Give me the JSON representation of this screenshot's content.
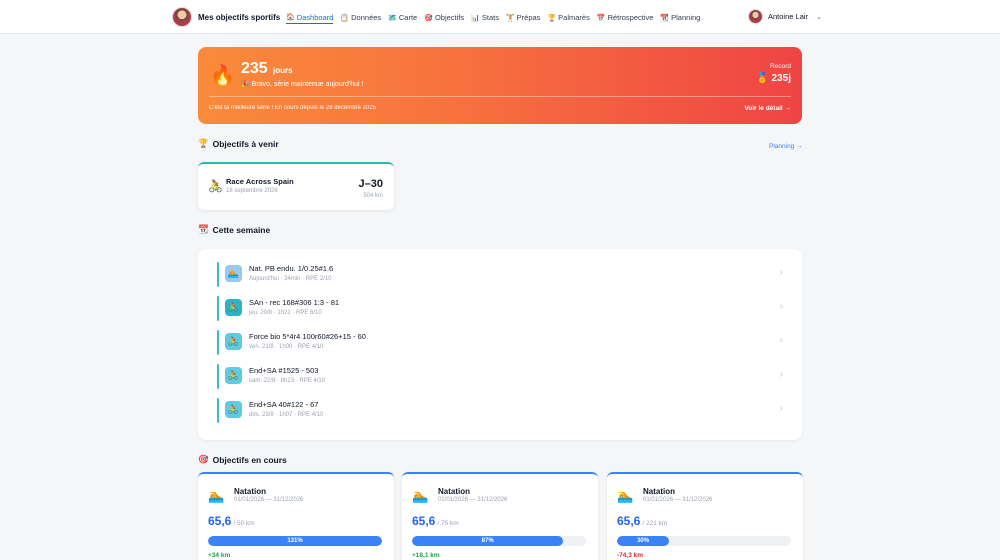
{
  "nav": {
    "brand": "Mes objectifs sportifs",
    "items": [
      {
        "icon": "🏠",
        "label": "Dashboard",
        "active": true
      },
      {
        "icon": "📋",
        "label": "Données"
      },
      {
        "icon": "🗺️",
        "label": "Carte"
      },
      {
        "icon": "🎯",
        "label": "Objectifs"
      },
      {
        "icon": "📊",
        "label": "Stats"
      },
      {
        "icon": "🏋️",
        "label": "Prépas"
      },
      {
        "icon": "🏆",
        "label": "Palmarès"
      },
      {
        "icon": "📅",
        "label": "Rétrospective"
      },
      {
        "icon": "📆",
        "label": "Planning"
      }
    ],
    "user": "Antoine Lair"
  },
  "streak": {
    "count": "235",
    "unit": "jours",
    "message": "🎉 Bravo, série maintenue aujourd'hui !",
    "record_label": "Record",
    "record_value": "235j",
    "footer": "C'est ta meilleure série ! En cours depuis le 28 décembre 2025",
    "link": "Voir le détail →"
  },
  "upcoming": {
    "title": "Objectifs à venir",
    "link": "Planning →",
    "goal": {
      "name": "Race Across Spain",
      "date": "18 septembre 2026",
      "countdown": "J–30",
      "distance": "504 km"
    }
  },
  "week": {
    "title": "Cette semaine",
    "sessions": [
      {
        "title": "Nat. PB endu. 1/0.25#1.6",
        "meta": "Aujourd'hui · 34min · RPE 2/10",
        "icon": "🏊",
        "bg": "#9ac8ee"
      },
      {
        "title": "SAn - rec 168#306 1:3 - 81",
        "meta": "jeu. 20/8 · 1h21 · RPE 6/10",
        "icon": "🚴",
        "bg": "#2bb3c9"
      },
      {
        "title": "Force bio 5*4r4 100r60#26+15 - 60",
        "meta": "ven. 21/8 · 1h00 · RPE 4/10",
        "icon": "🚴",
        "bg": "#5ecbe0"
      },
      {
        "title": "End+SA #1525 - 503",
        "meta": "sam. 22/8 · 8h23 · RPE 4/10",
        "icon": "🚴",
        "bg": "#5ecbe0"
      },
      {
        "title": "End+SA 40#122 - 67",
        "meta": "dim. 23/8 · 1h07 · RPE 4/10",
        "icon": "🚴",
        "bg": "#5ecbe0"
      }
    ]
  },
  "current": {
    "title": "Objectifs en cours",
    "goals": [
      {
        "name": "Natation",
        "dates": "01/01/2026 — 31/12/2026",
        "value": "65,6",
        "target": "/ 50 km",
        "progress": 1.0,
        "label": "131%",
        "delta": "+34 km",
        "delta_color": "#16a34a"
      },
      {
        "name": "Natation",
        "dates": "01/01/2026 — 31/12/2026",
        "value": "65,6",
        "target": "/ 75 km",
        "progress": 0.87,
        "label": "87%",
        "delta": "+18,1 km",
        "delta_color": "#16a34a"
      },
      {
        "name": "Natation",
        "dates": "01/01/2026 — 31/12/2026",
        "value": "65,6",
        "target": "/ 221 km",
        "progress": 0.3,
        "label": "30%",
        "delta": "-74,3 km",
        "delta_color": "#dc2626"
      }
    ]
  }
}
